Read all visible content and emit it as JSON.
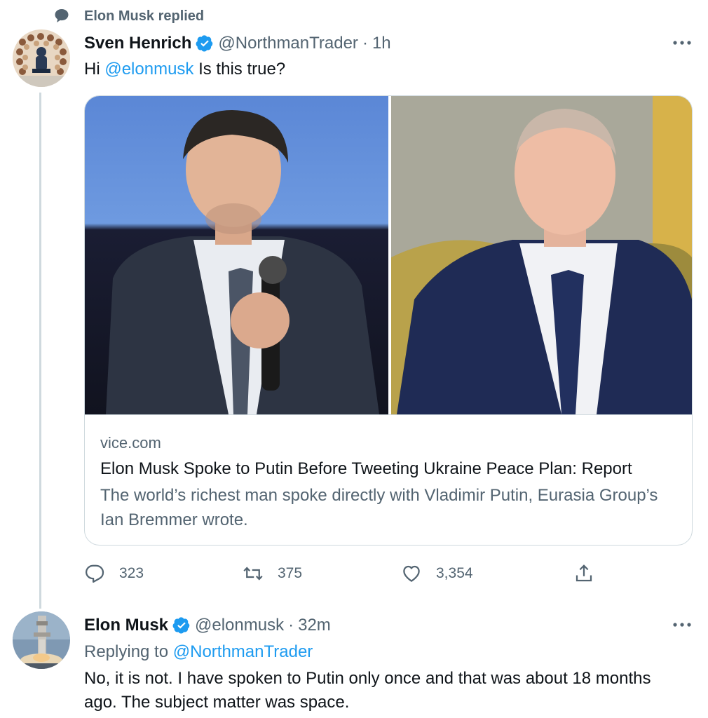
{
  "social_context": {
    "text": "Elon Musk replied",
    "icon": "speech-bubble-icon"
  },
  "tweet1": {
    "name": "Sven Henrich",
    "handle": "@NorthmanTrader",
    "separator": "·",
    "time": "1h",
    "text_prefix": "Hi ",
    "mention": "@elonmusk",
    "text_suffix": " Is this true?",
    "card": {
      "domain": "vice.com",
      "title": "Elon Musk Spoke to Putin Before Tweeting Ukraine Peace Plan: Report",
      "description": "The world’s richest man spoke directly with Vladimir Putin, Eurasia Group’s Ian Bremmer wrote."
    },
    "actions": {
      "replies": "323",
      "retweets": "375",
      "likes": "3,354"
    }
  },
  "tweet2": {
    "name": "Elon Musk",
    "handle": "@elonmusk",
    "separator": "·",
    "time": "32m",
    "replying_prefix": "Replying to ",
    "replying_to": "@NorthmanTrader",
    "text": "No, it is not. I have spoken to Putin only once and that was about 18 months ago. The subject matter was space."
  },
  "colors": {
    "accent": "#1d9bf0",
    "secondary_text": "#536471",
    "border": "#cfd9de"
  }
}
